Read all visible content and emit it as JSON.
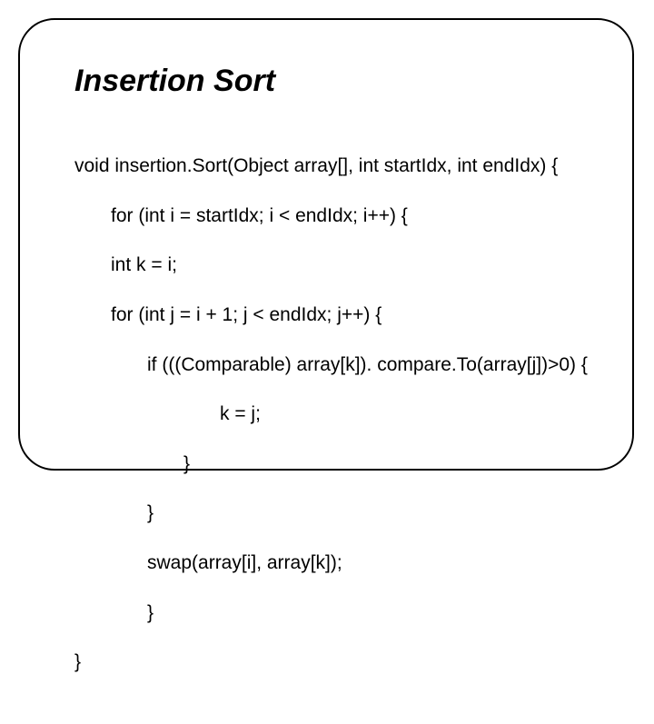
{
  "title": "Insertion Sort",
  "code": {
    "l1": "void insertion.Sort(Object array[], int startIdx, int endIdx) {",
    "l2": "for (int i = startIdx; i < endIdx; i++) {",
    "l3": "int k = i;",
    "l4": "for (int j = i + 1; j < endIdx; j++) {",
    "l5": "if (((Comparable) array[k]). compare.To(array[j])>0) {",
    "l6": "k = j;",
    "l7": "}",
    "l8": "}",
    "l9": "swap(array[i], array[k]);",
    "l10": "}",
    "l11": "}"
  }
}
